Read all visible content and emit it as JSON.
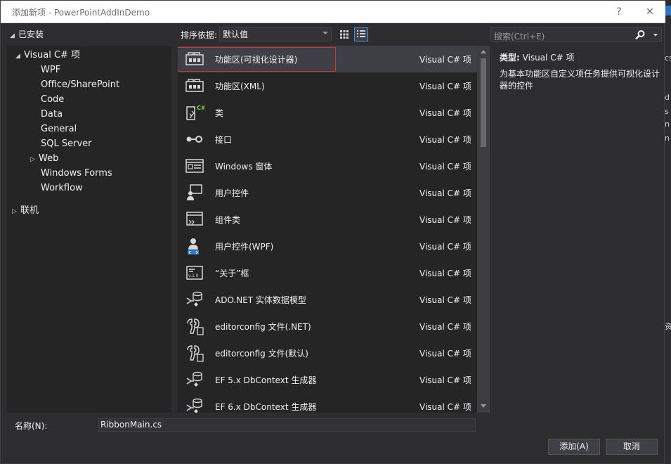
{
  "window": {
    "title": "添加新项 - PowerPointAddInDemo",
    "help_glyph": "?",
    "close_glyph": "✕"
  },
  "tree": {
    "installed_label": "已安装",
    "root_label": "Visual C# 项",
    "children": [
      "WPF",
      "Office/SharePoint",
      "Code",
      "Data",
      "General",
      "SQL Server",
      "Web",
      "Windows Forms",
      "Workflow"
    ],
    "online_label": "联机"
  },
  "toolbar": {
    "sort_label": "排序依据:",
    "sort_value": "默认值"
  },
  "search": {
    "placeholder": "搜索(Ctrl+E)"
  },
  "templates": [
    {
      "name": "功能区(可视化设计器)",
      "lang": "Visual C# 项",
      "icon": "ribbon-icon",
      "selected": true
    },
    {
      "name": "功能区(XML)",
      "lang": "Visual C# 项",
      "icon": "ribbon-icon"
    },
    {
      "name": "类",
      "lang": "Visual C# 项",
      "icon": "class-icon"
    },
    {
      "name": "接口",
      "lang": "Visual C# 项",
      "icon": "interface-icon"
    },
    {
      "name": "Windows 窗体",
      "lang": "Visual C# 项",
      "icon": "windows-form-icon"
    },
    {
      "name": "用户控件",
      "lang": "Visual C# 项",
      "icon": "user-control-icon"
    },
    {
      "name": "组件类",
      "lang": "Visual C# 项",
      "icon": "component-class-icon"
    },
    {
      "name": "用户控件(WPF)",
      "lang": "Visual C# 项",
      "icon": "wpf-user-control-icon"
    },
    {
      "name": "“关于”框",
      "lang": "Visual C# 项",
      "icon": "about-box-icon"
    },
    {
      "name": "ADO.NET 实体数据模型",
      "lang": "Visual C# 项",
      "icon": "data-model-icon"
    },
    {
      "name": "editorconfig 文件(.NET)",
      "lang": "Visual C# 项",
      "icon": "editorconfig-icon"
    },
    {
      "name": "editorconfig 文件(默认)",
      "lang": "Visual C# 项",
      "icon": "editorconfig-icon"
    },
    {
      "name": "EF 5.x DbContext 生成器",
      "lang": "Visual C# 项",
      "icon": "dbcontext-generator-icon"
    },
    {
      "name": "EF 6.x DbContext 生成器",
      "lang": "Visual C# 项",
      "icon": "dbcontext-generator-icon"
    }
  ],
  "details": {
    "type_label": "类型:",
    "type_value": "Visual C# 项",
    "description": "为基本功能区自定义项任务提供可视化设计器的控件"
  },
  "bottom": {
    "name_label": "名称(N):",
    "name_value": "RibbonMain.cs",
    "add_label": "添加(A)",
    "cancel_label": "取消"
  },
  "background": {
    "glyphs": [
      "cs",
      "d",
      "s",
      "n",
      "n",
      "资"
    ]
  },
  "colors": {
    "selection_outline": "#d13438",
    "accent": "#3399ff"
  }
}
